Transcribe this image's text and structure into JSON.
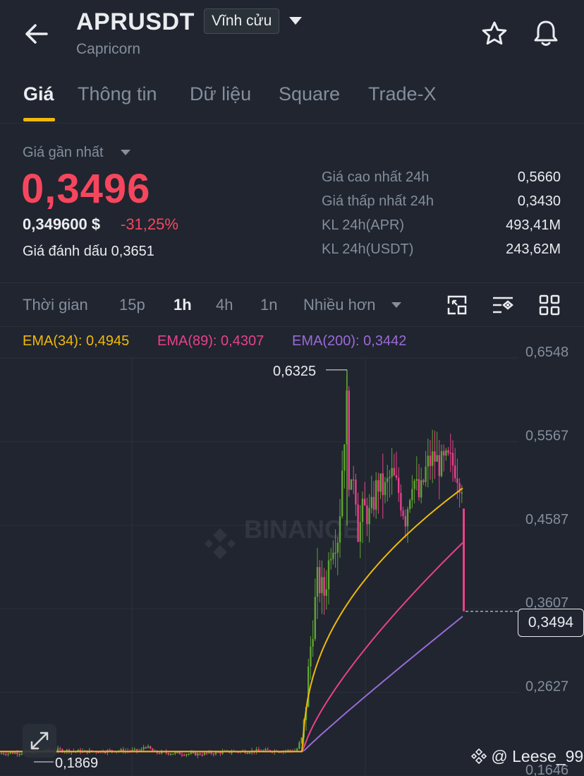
{
  "header": {
    "symbol": "APRUSDT",
    "contract_type": "Vĩnh cửu",
    "project_name": "Capricorn",
    "icons": [
      "back-arrow-icon",
      "star-icon",
      "bell-icon"
    ]
  },
  "tabs": [
    {
      "label": "Giá",
      "active": true
    },
    {
      "label": "Thông tin",
      "active": false
    },
    {
      "label": "Dữ liệu",
      "active": false
    },
    {
      "label": "Square",
      "active": false
    },
    {
      "label": "Trade-X",
      "active": false
    }
  ],
  "price": {
    "last_label": "Giá gần nhất",
    "last": "0,3496",
    "usd": "0,349600 $",
    "change": "-31,25%",
    "mark_label": "Giá đánh dấu",
    "mark": "0,3651"
  },
  "stats": [
    {
      "label": "Giá cao nhất 24h",
      "value": "0,5660"
    },
    {
      "label": "Giá thấp nhất 24h",
      "value": "0,3430"
    },
    {
      "label": "KL 24h(APR)",
      "value": "493,41M"
    },
    {
      "label": "KL 24h(USDT)",
      "value": "243,62M"
    }
  ],
  "intervals": {
    "time_label": "Thời gian",
    "options": [
      "15p",
      "1h",
      "4h",
      "1n"
    ],
    "active": "1h",
    "more_label": "Nhiều hơn"
  },
  "ema": [
    {
      "label": "EMA(34): 0,4945",
      "color": "#f0b90b"
    },
    {
      "label": "EMA(89): 0,4307",
      "color": "#e8418b"
    },
    {
      "label": "EMA(200): 0,3442",
      "color": "#9a6ad6"
    }
  ],
  "chart_data": {
    "type": "candlestick",
    "y_axis_labels": [
      "0,6548",
      "0,5567",
      "0,4587",
      "0,3607",
      "0,2627",
      "0,1646"
    ],
    "ylim": [
      0.1646,
      0.6548
    ],
    "high_marker": "0,6325",
    "low_marker": "0,1869",
    "current_price_tag": "0,3494",
    "up_color": "#5fa332",
    "down_color": "#e8418b",
    "grid": true
  },
  "watermark": {
    "brand": "BINANCE",
    "user": "@ Leese_99"
  }
}
